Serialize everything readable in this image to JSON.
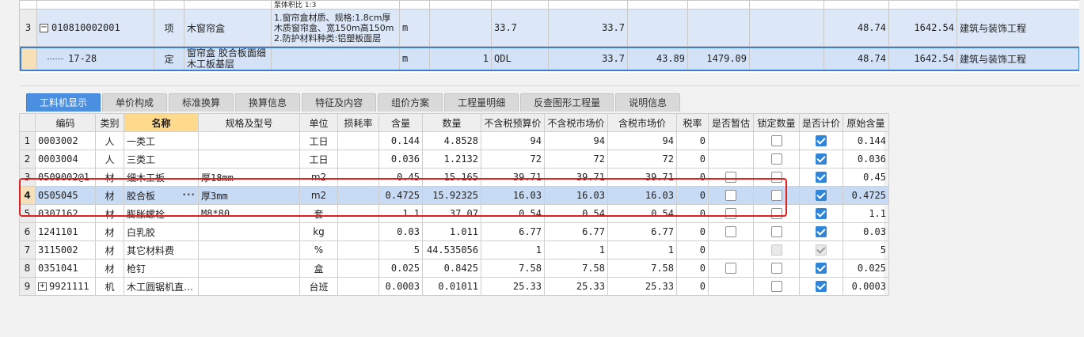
{
  "top_grid": {
    "partial_row_text": "泵体积比 1:3",
    "row_3": {
      "row_no": "3",
      "expand_symbol": "−",
      "code": "010810002001",
      "category": "项",
      "name": "木窗帘盒",
      "features": "1.窗帘盒材质、规格:1.8cm厚木质窗帘盒、宽150m高150m 2.防护材料种类:铝塑板面层",
      "unit": "m",
      "qty": "",
      "expr": "33.7",
      "quantity": "33.7",
      "price1": "",
      "price2": "",
      "unit_price": "48.74",
      "total": "1642.54",
      "discipline": "建筑与装饰工程"
    },
    "row_sub": {
      "code": "17-28",
      "category": "定",
      "name": "窗帘盒 胶合板面细木工板基层",
      "unit": "m",
      "qty": "1",
      "expr": "QDL",
      "quantity": "33.7",
      "price1": "43.89",
      "price2": "1479.09",
      "unit_price": "48.74",
      "total": "1642.54",
      "discipline": "建筑与装饰工程"
    }
  },
  "tabs": [
    {
      "label": "工料机显示",
      "active": true
    },
    {
      "label": "单价构成"
    },
    {
      "label": "标准换算"
    },
    {
      "label": "换算信息"
    },
    {
      "label": "特征及内容"
    },
    {
      "label": "组价方案"
    },
    {
      "label": "工程量明细"
    },
    {
      "label": "反查图形工程量"
    },
    {
      "label": "说明信息"
    }
  ],
  "table": {
    "headers": [
      "编码",
      "类别",
      "名称",
      "规格及型号",
      "单位",
      "损耗率",
      "含量",
      "数量",
      "不含税预算价",
      "不含税市场价",
      "含税市场价",
      "税率",
      "是否暂估",
      "锁定数量",
      "是否计价",
      "原始含量"
    ],
    "rows": [
      {
        "no": "1",
        "code": "0003002",
        "cat": "人",
        "name": "一类工",
        "spec": "",
        "unit": "工日",
        "loss": "",
        "content": "0.144",
        "qty": "4.8528",
        "budget": "94",
        "market": "94",
        "market_tax": "94",
        "tax": "0",
        "provisional": null,
        "lock": false,
        "priced": true,
        "lock_disabled": false,
        "priced_disabled": false,
        "orig": "0.144"
      },
      {
        "no": "2",
        "code": "0003004",
        "cat": "人",
        "name": "三类工",
        "spec": "",
        "unit": "工日",
        "loss": "",
        "content": "0.036",
        "qty": "1.2132",
        "budget": "72",
        "market": "72",
        "market_tax": "72",
        "tax": "0",
        "provisional": null,
        "lock": false,
        "priced": true,
        "lock_disabled": false,
        "priced_disabled": false,
        "orig": "0.036"
      },
      {
        "no": "3",
        "code": "0509002@1",
        "cat": "材",
        "name": "细木工板",
        "spec": "厚18mm",
        "unit": "m2",
        "loss": "",
        "content": "0.45",
        "qty": "15.165",
        "budget": "39.71",
        "market": "39.71",
        "market_tax": "39.71",
        "tax": "0",
        "provisional": false,
        "lock": false,
        "priced": true,
        "lock_disabled": false,
        "priced_disabled": false,
        "orig": "0.45"
      },
      {
        "no": "4",
        "code": "0505045",
        "cat": "材",
        "name": "胶合板",
        "spec": "厚3mm",
        "unit": "m2",
        "loss": "",
        "content": "0.4725",
        "qty": "15.92325",
        "budget": "16.03",
        "market": "16.03",
        "market_tax": "16.03",
        "tax": "0",
        "provisional": false,
        "lock": false,
        "priced": true,
        "lock_disabled": false,
        "priced_disabled": false,
        "orig": "0.4725",
        "selected": true,
        "ellipsis": "···"
      },
      {
        "no": "5",
        "code": "0307162",
        "cat": "材",
        "name": "膨胀螺栓",
        "spec": "M8*80",
        "unit": "套",
        "loss": "",
        "content": "1.1",
        "qty": "37.07",
        "budget": "0.54",
        "market": "0.54",
        "market_tax": "0.54",
        "tax": "0",
        "provisional": false,
        "lock": false,
        "priced": true,
        "lock_disabled": false,
        "priced_disabled": false,
        "orig": "1.1"
      },
      {
        "no": "6",
        "code": "1241101",
        "cat": "材",
        "name": "白乳胶",
        "spec": "",
        "unit": "kg",
        "loss": "",
        "content": "0.03",
        "qty": "1.011",
        "budget": "6.77",
        "market": "6.77",
        "market_tax": "6.77",
        "tax": "0",
        "provisional": false,
        "lock": false,
        "priced": true,
        "lock_disabled": false,
        "priced_disabled": false,
        "orig": "0.03"
      },
      {
        "no": "7",
        "code": "3115002",
        "cat": "材",
        "name": "其它材料费",
        "spec": "",
        "unit": "%",
        "loss": "",
        "content": "5",
        "qty": "44.535056",
        "budget": "1",
        "market": "1",
        "market_tax": "1",
        "tax": "0",
        "provisional": null,
        "lock": false,
        "priced": true,
        "lock_disabled": true,
        "priced_disabled": true,
        "orig": "5"
      },
      {
        "no": "8",
        "code": "0351041",
        "cat": "材",
        "name": "枪钉",
        "spec": "",
        "unit": "盒",
        "loss": "",
        "content": "0.025",
        "qty": "0.8425",
        "budget": "7.58",
        "market": "7.58",
        "market_tax": "7.58",
        "tax": "0",
        "provisional": false,
        "lock": false,
        "priced": true,
        "lock_disabled": false,
        "priced_disabled": false,
        "orig": "0.025"
      },
      {
        "no": "9",
        "code": "9921111",
        "cat": "机",
        "name": "木工圆锯机直…",
        "spec": "",
        "unit": "台班",
        "loss": "",
        "content": "0.0003",
        "qty": "0.01011",
        "budget": "25.33",
        "market": "25.33",
        "market_tax": "25.33",
        "tax": "0",
        "provisional": null,
        "lock": false,
        "priced": true,
        "lock_disabled": false,
        "priced_disabled": false,
        "orig": "0.0003",
        "expand": "+"
      }
    ]
  }
}
